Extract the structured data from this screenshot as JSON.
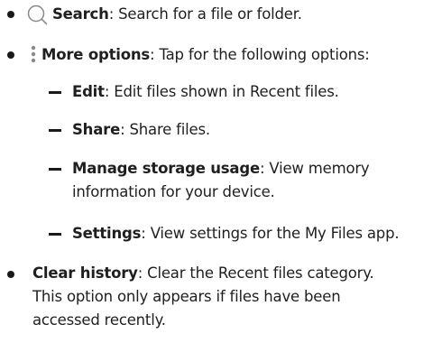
{
  "colors": {
    "text": "#1f1f1f",
    "icon": "#8a8a8a",
    "bullet": "#1a1a1a"
  },
  "items": [
    {
      "icon": "search-icon",
      "term": "Search",
      "sep": ": ",
      "desc": "Search for a file or folder."
    },
    {
      "icon": "more-options-icon",
      "term": "More options",
      "sep": ": ",
      "desc": "Tap for the following options:",
      "subitems": [
        {
          "term": "Edit",
          "sep": ": ",
          "desc": "Edit files shown in Recent files."
        },
        {
          "term": "Share",
          "sep": ": ",
          "desc": "Share files."
        },
        {
          "term": "Manage storage usage",
          "sep": ": ",
          "desc": "View memory",
          "desc_cont": "information for your device."
        },
        {
          "term": "Settings",
          "sep": ": ",
          "desc": "View settings for the My Files app."
        }
      ]
    },
    {
      "term": "Clear history",
      "sep": ": ",
      "desc": "Clear the Recent files category.",
      "desc_line2": "This option only appears if files have been",
      "desc_line3": "accessed recently."
    }
  ]
}
